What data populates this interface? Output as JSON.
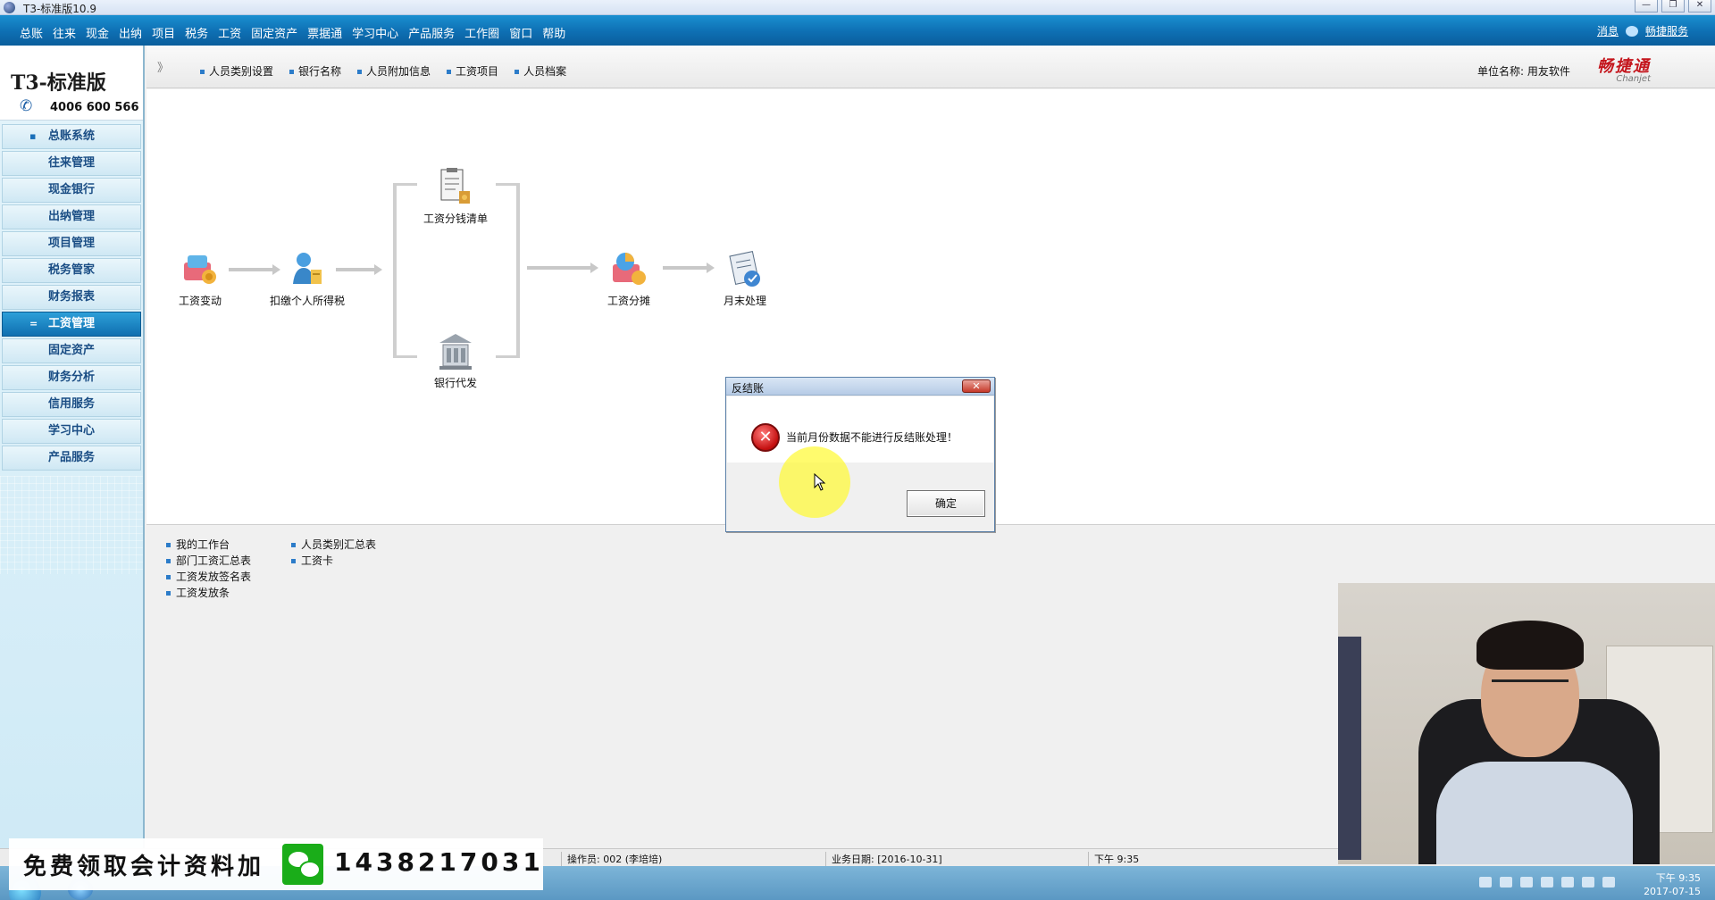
{
  "window": {
    "title": "T3-标准版10.9",
    "controls": [
      "—",
      "❐",
      "✕"
    ]
  },
  "menubar": {
    "items": [
      "总账",
      "往来",
      "现金",
      "出纳",
      "项目",
      "税务",
      "工资",
      "固定资产",
      "票据通",
      "学习中心",
      "产品服务",
      "工作圈",
      "窗口",
      "帮助"
    ],
    "right": {
      "messages": "消息",
      "service": "畅捷服务"
    }
  },
  "sidebar": {
    "brand": "T3-标准版",
    "phone": "4006 600 566",
    "items": [
      {
        "label": "总账系统",
        "active": false
      },
      {
        "label": "往来管理",
        "active": false
      },
      {
        "label": "现金银行",
        "active": false
      },
      {
        "label": "出纳管理",
        "active": false
      },
      {
        "label": "项目管理",
        "active": false
      },
      {
        "label": "税务管家",
        "active": false
      },
      {
        "label": "财务报表",
        "active": false
      },
      {
        "label": "工资管理",
        "active": true
      },
      {
        "label": "固定资产",
        "active": false
      },
      {
        "label": "财务分析",
        "active": false
      },
      {
        "label": "信用服务",
        "active": false
      },
      {
        "label": "学习中心",
        "active": false
      },
      {
        "label": "产品服务",
        "active": false
      }
    ]
  },
  "toolbar": {
    "chevron": "》",
    "links": [
      "人员类别设置",
      "银行名称",
      "人员附加信息",
      "工资项目",
      "人员档案"
    ],
    "unit_label": "单位名称: 用友软件",
    "brand_cn": "畅捷通",
    "brand_en": "Chanjet"
  },
  "workflow": {
    "nodes": {
      "wage_change": "工资变动",
      "income_tax": "扣缴个人所得税",
      "wage_list": "工资分钱清单",
      "bank_payment": "银行代发",
      "wage_allocation": "工资分摊",
      "month_end": "月末处理"
    }
  },
  "reports": {
    "col1": [
      "我的工作台",
      "部门工资汇总表",
      "工资发放签名表",
      "工资发放条"
    ],
    "col2": [
      "人员类别汇总表",
      "工资卡"
    ]
  },
  "statusbar": {
    "operator": "操作员: 002 (李培培)",
    "business_date": "业务日期: [2016-10-31]",
    "time": "下午 9:35"
  },
  "taskbar": {
    "time": "下午 9:35",
    "date": "2017-07-15"
  },
  "dialog": {
    "title": "反结账",
    "close": "✕",
    "message": "当前月份数据不能进行反结账处理！",
    "ok": "确定"
  },
  "promo": {
    "text": "免费领取会计资料加",
    "number": "1438217031"
  },
  "colors": {
    "menubar": "#0e6fb3",
    "active_nav": "#1680c4",
    "brand_red": "#c4151c",
    "highlight": "#fffa3c"
  }
}
